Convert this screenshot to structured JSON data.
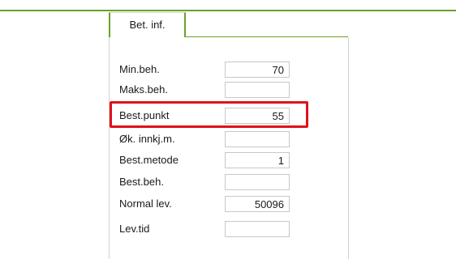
{
  "tab": {
    "label": "Bet. inf."
  },
  "fields": [
    {
      "label": "Min.beh.",
      "value": "70"
    },
    {
      "label": "Maks.beh.",
      "value": ""
    },
    {
      "label": "Best.punkt",
      "value": "55"
    },
    {
      "label": "Øk. innkj.m.",
      "value": ""
    },
    {
      "label": "Best.metode",
      "value": "1"
    },
    {
      "label": "Best.beh.",
      "value": ""
    },
    {
      "label": "Normal lev.",
      "value": "50096"
    },
    {
      "label": "Lev.tid",
      "value": ""
    }
  ],
  "highlight": {
    "target": "Best.punkt",
    "color": "#e0101a"
  },
  "colors": {
    "accent": "#6aa12a"
  }
}
